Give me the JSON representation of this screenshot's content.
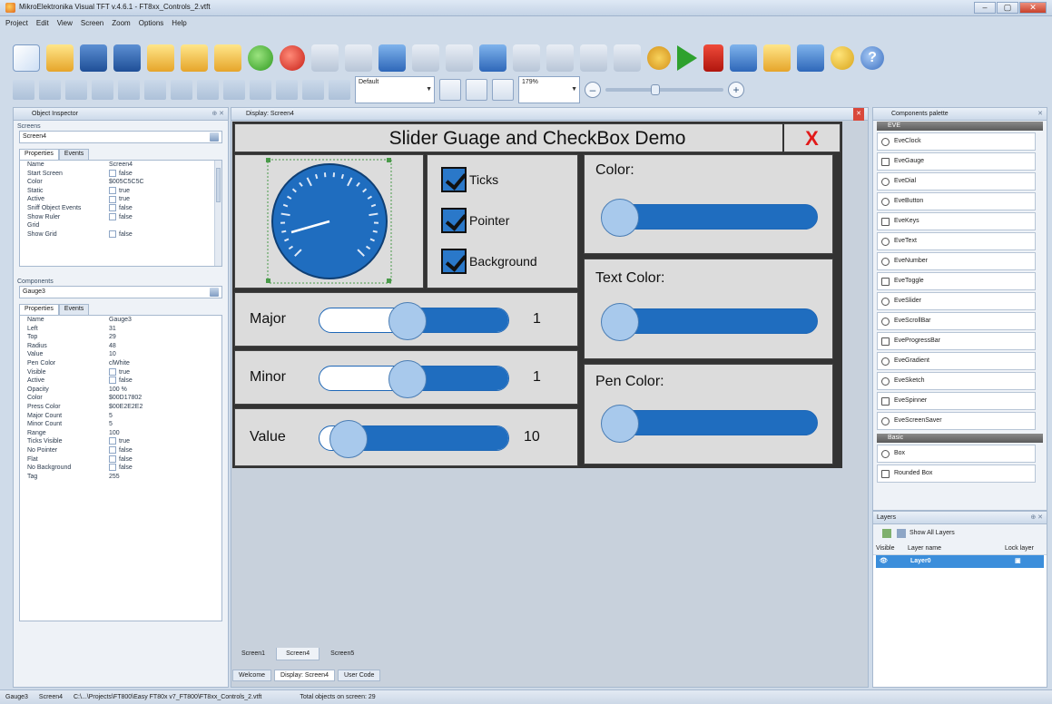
{
  "window": {
    "title": "MikroElektronika Visual TFT v.4.6.1 - FT8xx_Controls_2.vtft",
    "buttons": [
      "–",
      "▢",
      "✕"
    ]
  },
  "menu": [
    "Project",
    "Edit",
    "View",
    "Screen",
    "Zoom",
    "Options",
    "Help"
  ],
  "toolbar2": {
    "layer_select": "Default",
    "zoom_value": "179%"
  },
  "object_inspector": {
    "title": "Object Inspector",
    "screens_label": "Screens",
    "screen_selected": "Screen4",
    "tabs": [
      "Properties",
      "Events"
    ],
    "screen_props": [
      {
        "k": "Name",
        "v": "Screen4"
      },
      {
        "k": "Start Screen",
        "v": "false",
        "check": true
      },
      {
        "k": "Color",
        "v": "$005C5C5C"
      },
      {
        "k": "Static",
        "v": "true",
        "check": true
      },
      {
        "k": "Active",
        "v": "true",
        "check": true
      },
      {
        "k": "Sniff Object Events",
        "v": "false",
        "check": true
      },
      {
        "k": "Show Ruler",
        "v": "false",
        "check": true
      },
      {
        "k": "Grid",
        "v": ""
      },
      {
        "k": "Show Grid",
        "v": "false",
        "check": true
      }
    ],
    "components_label": "Components",
    "component_selected": "Gauge3",
    "component_tabs": [
      "Properties",
      "Events"
    ],
    "component_props": [
      {
        "k": "Name",
        "v": "Gauge3"
      },
      {
        "k": "Left",
        "v": "31"
      },
      {
        "k": "Top",
        "v": "29"
      },
      {
        "k": "Radius",
        "v": "48"
      },
      {
        "k": "Value",
        "v": "10"
      },
      {
        "k": "Pen Color",
        "v": "clWhite"
      },
      {
        "k": "Visible",
        "v": "true",
        "check": true
      },
      {
        "k": "Active",
        "v": "false",
        "check": true
      },
      {
        "k": "Opacity",
        "v": "100 %"
      },
      {
        "k": "Color",
        "v": "$00D17802"
      },
      {
        "k": "Press Color",
        "v": "$00E2E2E2"
      },
      {
        "k": "Major Count",
        "v": "5"
      },
      {
        "k": "Minor Count",
        "v": "5"
      },
      {
        "k": "Range",
        "v": "100"
      },
      {
        "k": "Ticks Visible",
        "v": "true",
        "check": true
      },
      {
        "k": "No Pointer",
        "v": "false",
        "check": true
      },
      {
        "k": "Flat",
        "v": "false",
        "check": true
      },
      {
        "k": "No Background",
        "v": "false",
        "check": true
      },
      {
        "k": "Tag",
        "v": "255"
      }
    ]
  },
  "display": {
    "title": "Display: Screen4",
    "demo_title": "Slider Guage and CheckBox Demo",
    "close_label": "X",
    "checkboxes": [
      "Ticks",
      "Pointer",
      "Background"
    ],
    "sliders": [
      {
        "label": "Major",
        "value": "1",
        "fraction": 0.45
      },
      {
        "label": "Minor",
        "value": "1",
        "fraction": 0.45
      },
      {
        "label": "Value",
        "value": "10",
        "fraction": 0.1
      }
    ],
    "color_panels": [
      "Color:",
      "Text Color:",
      "Pen Color:"
    ],
    "screen_tabs": [
      "Screen1",
      "Screen4",
      "Screen5"
    ],
    "doc_tabs": [
      "Welcome",
      "Display: Screen4",
      "User Code"
    ]
  },
  "palette": {
    "title": "Components palette",
    "group_eve": "EVE",
    "eve_items": [
      "EveClock",
      "EveGauge",
      "EveDial",
      "EveButton",
      "EveKeys",
      "EveText",
      "EveNumber",
      "EveToggle",
      "EveSlider",
      "EveScrollBar",
      "EveProgressBar",
      "EveGradient",
      "EveSketch",
      "EveSpinner",
      "EveScreenSaver"
    ],
    "group_basic": "Basic",
    "basic_items": [
      "Box",
      "Rounded Box"
    ]
  },
  "layers": {
    "title": "Layers",
    "show_all": "Show All Layers",
    "col_visible": "Visible",
    "col_name": "Layer name",
    "col_lock": "Lock layer",
    "row_name": "Layer0"
  },
  "statusbar": {
    "selected": "Gauge3",
    "screen": "Screen4",
    "path": "C:\\...\\Projects\\FT800\\Easy FT80x v7_FT800\\FT8xx_Controls_2.vtft",
    "objects": "Total objects on screen: 29"
  }
}
